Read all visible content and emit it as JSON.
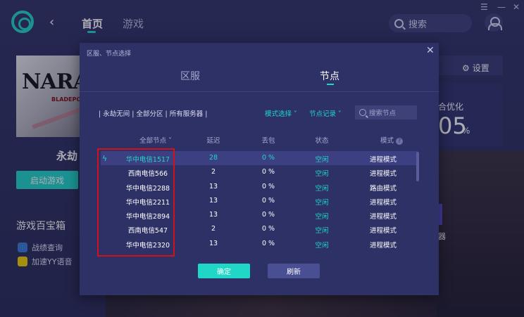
{
  "topbar": {
    "nav_home": "首页",
    "nav_game": "游戏",
    "search_placeholder": "搜索",
    "win_minimize": "—",
    "win_close": "✕",
    "win_menu": "☰"
  },
  "game": {
    "cover_logo": "NARAK",
    "cover_sub": "BLADEPOINT",
    "name": "永劫",
    "start_button": "启动游戏"
  },
  "toolbox": {
    "title": "游戏百宝箱",
    "items": [
      {
        "label": "战绩查询",
        "icon": "search-stats-icon",
        "color": "#3a7bd5"
      },
      {
        "label": "加速YY语音",
        "icon": "yy-icon",
        "color": "#f5d000"
      }
    ]
  },
  "right_panel": {
    "settings_label": "设置",
    "opt_label": "合优化",
    "opt_value": "05",
    "opt_unit": "%",
    "side_text": "器"
  },
  "modal": {
    "title": "区服、节点选择",
    "close": "✕",
    "tabs": [
      {
        "label": "区服",
        "active": false
      },
      {
        "label": "节点",
        "active": true
      }
    ],
    "filter_path": "| 永劫无间 | 全部分区 | 所有服务器 |",
    "mode_select": "模式选择 ˅",
    "node_record": "节点记录 ˅",
    "search_placeholder": "搜索节点",
    "columns": {
      "node": "全部节点 ˅",
      "latency": "延迟",
      "loss": "丢包",
      "status": "状态",
      "mode": "模式"
    },
    "rows": [
      {
        "node": "华中电信1517",
        "latency": "28",
        "loss": "0 %",
        "status": "空闲",
        "mode": "进程模式"
      },
      {
        "node": "西南电信566",
        "latency": "2",
        "loss": "0 %",
        "status": "空闲",
        "mode": "进程模式"
      },
      {
        "node": "华中电信2288",
        "latency": "13",
        "loss": "0 %",
        "status": "空闲",
        "mode": "路由模式"
      },
      {
        "node": "华中电信2211",
        "latency": "13",
        "loss": "0 %",
        "status": "空闲",
        "mode": "进程模式"
      },
      {
        "node": "华中电信2894",
        "latency": "13",
        "loss": "0 %",
        "status": "空闲",
        "mode": "进程模式"
      },
      {
        "node": "西南电信547",
        "latency": "2",
        "loss": "0 %",
        "status": "空闲",
        "mode": "进程模式"
      },
      {
        "node": "华中电信2320",
        "latency": "13",
        "loss": "0 %",
        "status": "空闲",
        "mode": "进程模式"
      }
    ],
    "confirm_button": "确定",
    "refresh_button": "刷新"
  },
  "colors": {
    "accent": "#1fd6c7",
    "highlight_box": "#d0121b"
  }
}
